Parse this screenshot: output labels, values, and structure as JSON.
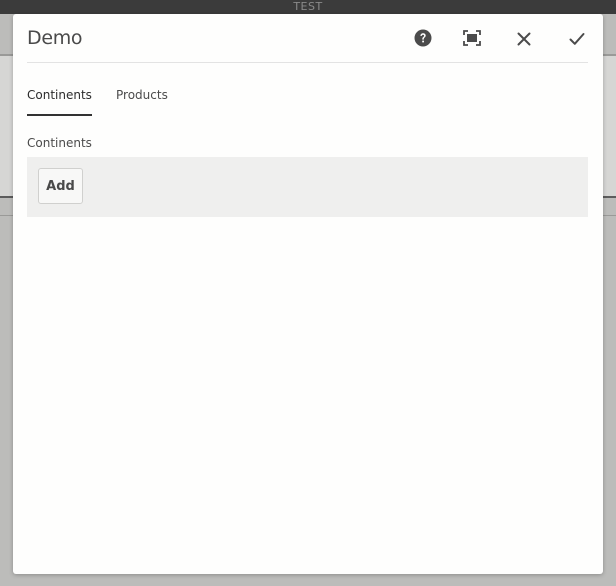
{
  "window": {
    "caption": "TEST"
  },
  "dialog": {
    "title": "Demo",
    "header_actions": [
      {
        "name": "help",
        "icon": "help-icon"
      },
      {
        "name": "fullscreen",
        "icon": "fullscreen-icon"
      },
      {
        "name": "close",
        "icon": "close-icon"
      },
      {
        "name": "done",
        "icon": "checkmark-icon"
      }
    ],
    "tabs": [
      {
        "label": "Continents",
        "selected": true
      },
      {
        "label": "Products",
        "selected": false
      }
    ],
    "content": {
      "field_label": "Continents",
      "add_label": "Add"
    }
  },
  "colors": {
    "backdrop": "#bcbcba",
    "titlebar": "#3b3b3b",
    "dialog_bg": "#fefefd",
    "multifield_bg": "#efefee",
    "text": "#4b4b4b",
    "active_tab_underline": "#323232"
  }
}
